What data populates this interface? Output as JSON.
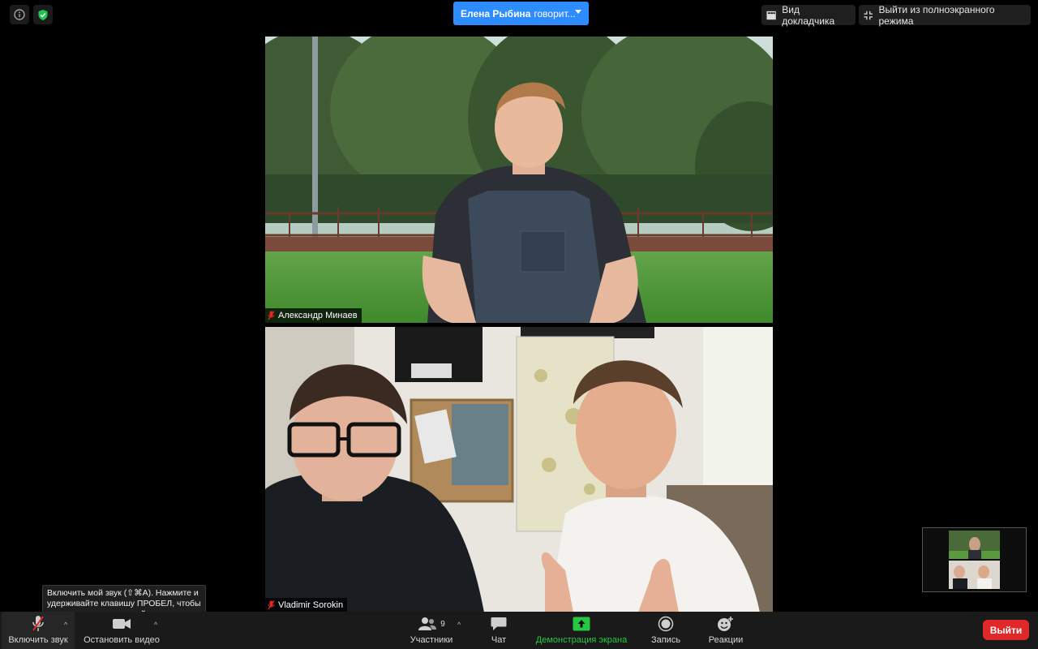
{
  "banner": {
    "speaker_name": "Елена Рыбина",
    "speaking_text": "говорит..."
  },
  "top_buttons": {
    "speaker_view": "Вид докладчика",
    "exit_fullscreen": "Выйти из полноэкранного режима"
  },
  "tiles": [
    {
      "name": "Александр Минаев",
      "muted": true
    },
    {
      "name": "Vladimir Sorokin",
      "muted": true
    }
  ],
  "tooltip": {
    "text": "Включить мой звук (⇧⌘A). Нажмите и удерживайте клавишу ПРОБЕЛ, чтобы временно включить свой звук."
  },
  "toolbar": {
    "unmute_label": "Включить звук",
    "stop_video_label": "Остановить видео",
    "participants_label": "Участники",
    "participants_count": "9",
    "chat_label": "Чат",
    "share_label": "Демонстрация экрана",
    "record_label": "Запись",
    "reactions_label": "Реакции",
    "leave_label": "Выйти"
  },
  "colors": {
    "accent_blue": "#2d8cff",
    "share_green": "#26c843",
    "leave_red": "#e02828"
  }
}
